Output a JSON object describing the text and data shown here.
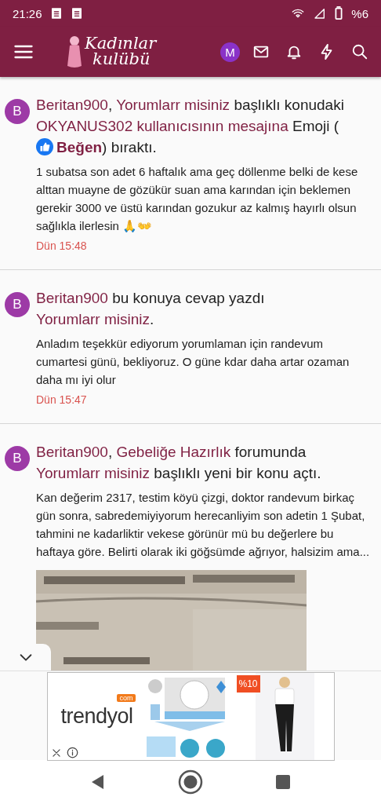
{
  "status_bar": {
    "time": "21:26",
    "battery": "%6"
  },
  "header": {
    "logo_line1": "Kadınlar",
    "logo_line2": "kulübü",
    "account_initial": "M"
  },
  "feed": [
    {
      "avatar": "B",
      "sentence": [
        {
          "kind": "link",
          "text": "Beritan900"
        },
        {
          "kind": "plain",
          "text": ", "
        },
        {
          "kind": "link",
          "text": "Yorumlarr misiniz"
        },
        {
          "kind": "plain",
          "text": " başlıklı konudaki "
        },
        {
          "kind": "link",
          "text": "OKYANUS302 kullanıcısının mesajına"
        },
        {
          "kind": "plain",
          "text": " Emoji ("
        },
        {
          "kind": "reaction",
          "text": "Beğen"
        },
        {
          "kind": "plain",
          "text": ") bıraktı."
        }
      ],
      "excerpt": "1 subatsa son adet 6 haftalık ama geç döllenme belki de kese alttan muayne de gözükür suan ama karından için beklemen gerekir 3000 ve üstü karından gozukur az kalmış hayırlı olsun sağlıkla ilerlesin 🙏👐",
      "time": "Dün 15:48"
    },
    {
      "avatar": "B",
      "sentence": [
        {
          "kind": "link",
          "text": "Beritan900"
        },
        {
          "kind": "plain",
          "text": " bu konuya cevap yazdı "
        },
        {
          "kind": "link",
          "text": "Yorumlarr misiniz"
        },
        {
          "kind": "plain",
          "text": "."
        }
      ],
      "excerpt": "Anladım teşekkür ediyorum yorumlaman için randevum cumartesi günü, bekliyoruz. O güne kdar daha artar ozaman daha mı iyi olur",
      "time": "Dün 15:47"
    },
    {
      "avatar": "B",
      "sentence": [
        {
          "kind": "link",
          "text": "Beritan900"
        },
        {
          "kind": "plain",
          "text": ", "
        },
        {
          "kind": "link",
          "text": "Gebeliğe Hazırlık"
        },
        {
          "kind": "plain",
          "text": " forumunda "
        },
        {
          "kind": "link",
          "text": "Yorumlarr misiniz"
        },
        {
          "kind": "plain",
          "text": " başlıklı yeni bir konu açtı."
        }
      ],
      "excerpt": "Kan değerim 2317, testim köyü çizgi, doktor randevum birkaç gün sonra, sabredemiyiyorum herecanliyim son adetin 1 Şubat, tahmini ne kadarliktir vekese görünür mü bu değerlere bu haftaya göre. Belirti olarak iki göğsümde ağrıyor, halsizim ama..."
    }
  ],
  "ad": {
    "brand": "trendyol",
    "brand_suffix": "com",
    "discount": "%10"
  }
}
